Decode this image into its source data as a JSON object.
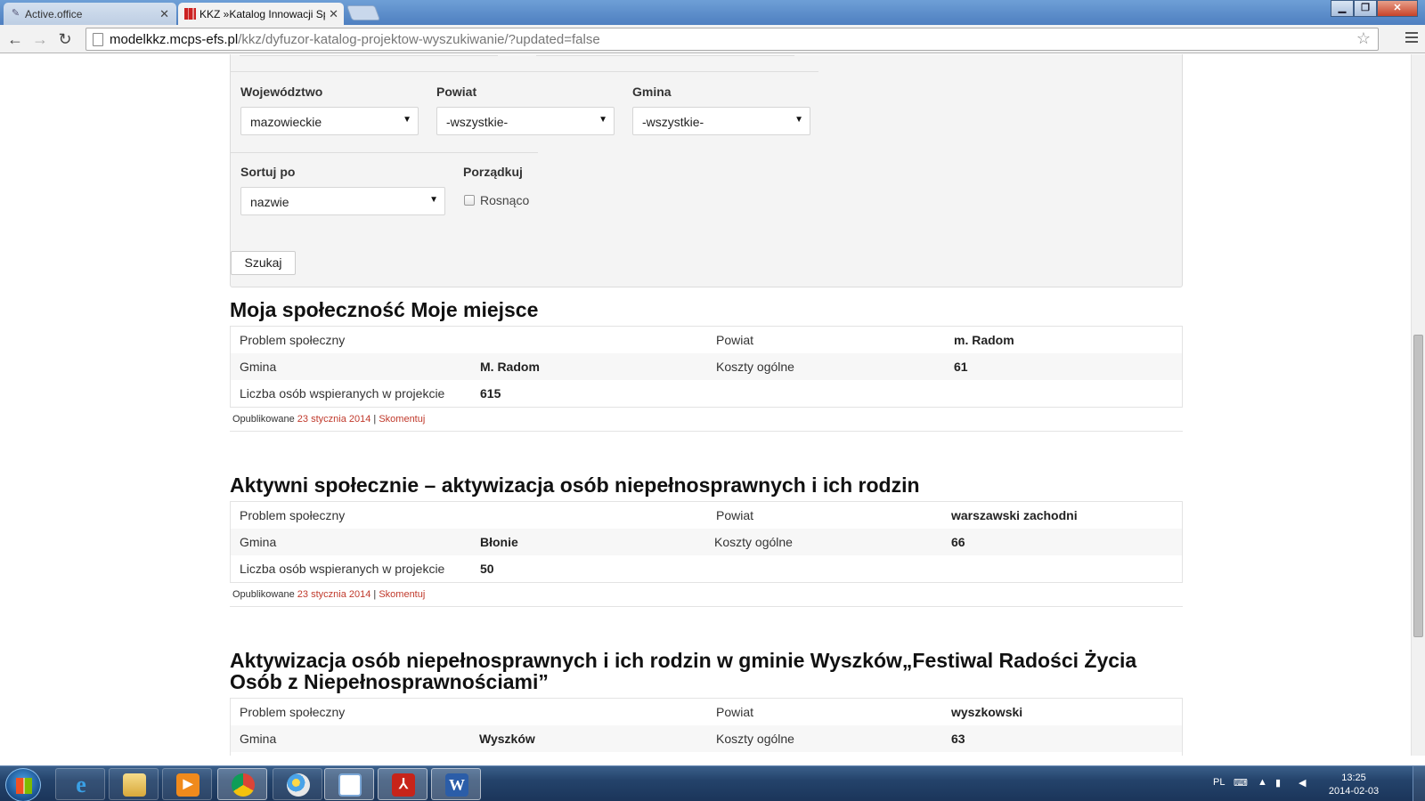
{
  "browser": {
    "window_title": "Katalog Innowacji Społecznych - Google Chrome",
    "tabs": [
      {
        "title": "Active.office",
        "active": false
      },
      {
        "title": "KKZ »Katalog Innowacji Sp",
        "active": true
      }
    ],
    "url_host": "modelkkz.mcps-efs.pl",
    "url_path": "/kkz/dyfuzor-katalog-projektow-wyszukiwanie/?updated=false"
  },
  "filters": {
    "wojewodztwo_label": "Województwo",
    "wojewodztwo_value": "mazowieckie",
    "powiat_label": "Powiat",
    "powiat_value": "-wszystkie-",
    "gmina_label": "Gmina",
    "gmina_value": "-wszystkie-",
    "sortuj_label": "Sortuj po",
    "sortuj_value": "nazwie",
    "porzadkuj_label": "Porządkuj",
    "rosnaco_label": "Rosnąco",
    "rosnaco_checked": false,
    "search_button": "Szukaj"
  },
  "field_labels": {
    "problem": "Problem społeczny",
    "powiat": "Powiat",
    "gmina": "Gmina",
    "koszty": "Koszty ogólne",
    "liczba": "Liczba osób wspieranych w projekcie"
  },
  "results": [
    {
      "title": "Moja społeczność Moje miejsce",
      "powiat": "m. Radom",
      "gmina": "M. Radom",
      "koszty": "61",
      "liczba": "615",
      "published_prefix": "Opublikowane",
      "published_date": "23 stycznia 2014",
      "separator": "|",
      "comment": "Skomentuj"
    },
    {
      "title": "Aktywni społecznie – aktywizacja osób niepełnosprawnych i ich rodzin",
      "powiat": "warszawski zachodni",
      "gmina": "Błonie",
      "koszty": "66",
      "liczba": "50",
      "published_prefix": "Opublikowane",
      "published_date": "23 stycznia 2014",
      "separator": "|",
      "comment": "Skomentuj"
    },
    {
      "title_line1": "Aktywizacja osób niepełnosprawnych i ich rodzin w gminie Wyszków„Festiwal Radości Życia",
      "title_line2": "Osób z Niepełnosprawnościami”",
      "powiat": "wyszkowski",
      "gmina": "Wyszków",
      "koszty": "63"
    }
  ],
  "taskbar": {
    "language": "PL",
    "time": "13:25",
    "date": "2014-02-03"
  }
}
